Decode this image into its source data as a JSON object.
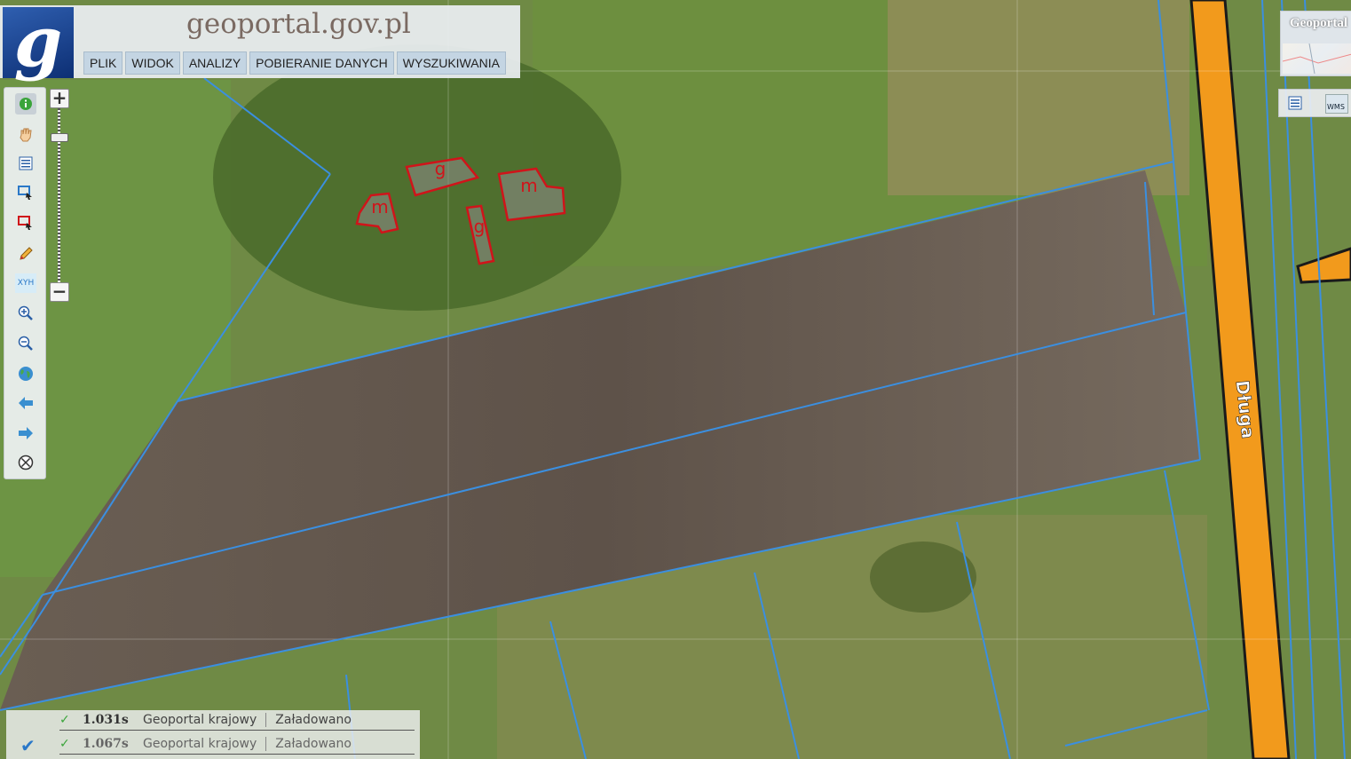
{
  "header": {
    "site_title": "geoportal.gov.pl",
    "logo_letter": "g",
    "menu": [
      "PLIK",
      "WIDOK",
      "ANALIZY",
      "POBIERANIE DANYCH",
      "WYSZUKIWANIA"
    ]
  },
  "toolbar": {
    "tools": [
      {
        "name": "info-icon",
        "glyph": "i"
      },
      {
        "name": "pan-hand-icon",
        "glyph": "✋"
      },
      {
        "name": "layers-list-icon",
        "glyph": "☰"
      },
      {
        "name": "select-blue-rect-icon",
        "glyph": "▭"
      },
      {
        "name": "select-red-rect-icon",
        "glyph": "▭"
      },
      {
        "name": "pencil-icon",
        "glyph": "✎"
      },
      {
        "name": "xyh-coordinates-icon",
        "glyph": "XYH"
      },
      {
        "name": "zoom-in-icon",
        "glyph": "⊕"
      },
      {
        "name": "zoom-out-icon",
        "glyph": "⊖"
      },
      {
        "name": "globe-icon",
        "glyph": "●"
      },
      {
        "name": "back-arrow-icon",
        "glyph": "⬅"
      },
      {
        "name": "forward-arrow-icon",
        "glyph": "➡"
      },
      {
        "name": "clear-icon",
        "glyph": "⊗"
      }
    ]
  },
  "zoom": {
    "plus": "+",
    "minus": "−"
  },
  "minimap": {
    "title": "Geoportal"
  },
  "right_tools": {
    "wms_label": "WMS"
  },
  "map": {
    "street_label": "Długa",
    "building_labels": [
      "g",
      "m",
      "m",
      "g"
    ],
    "colors": {
      "parcel": "#3b8fe0",
      "building": "#d0141a",
      "road": "#f29a1c",
      "road_edge": "#1a1a1a"
    }
  },
  "status": {
    "rows": [
      {
        "time": "1.031s",
        "source": "Geoportal krajowy",
        "state": "Załadowano"
      },
      {
        "time": "1.067s",
        "source": "Geoportal krajowy",
        "state": "Załadowano"
      }
    ]
  }
}
